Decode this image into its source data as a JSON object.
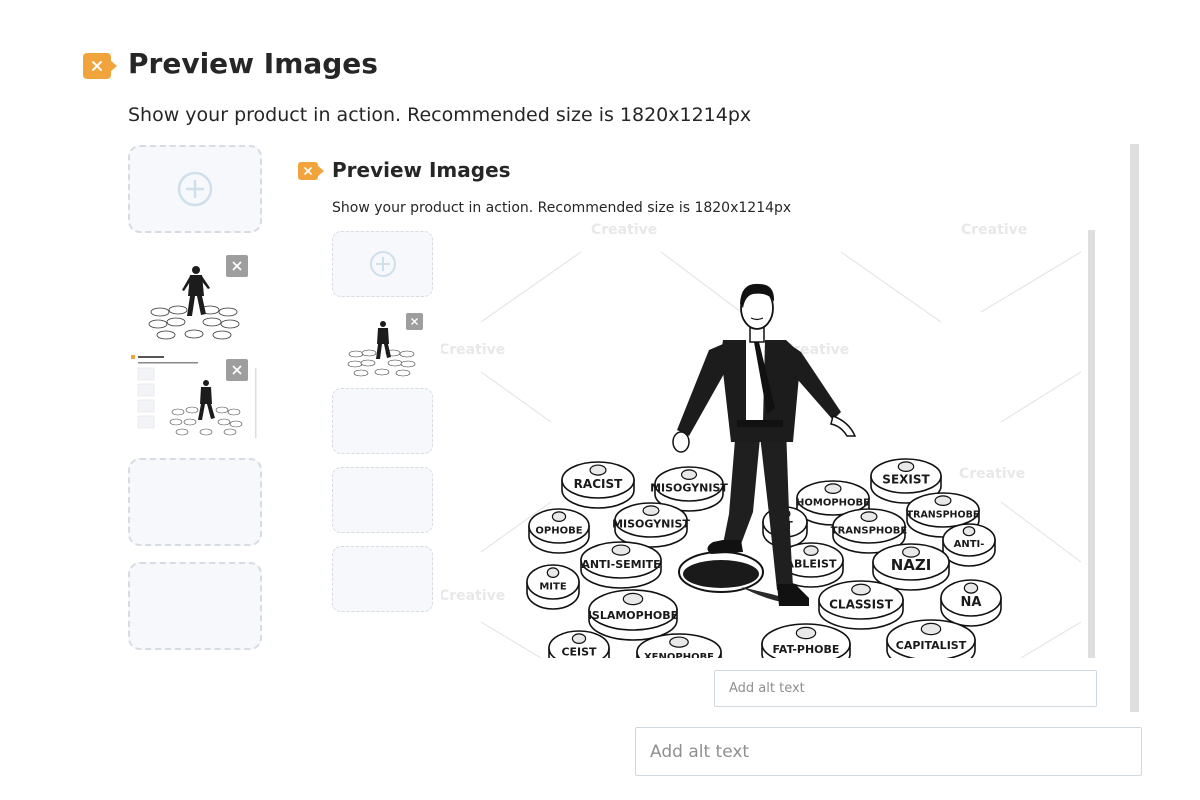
{
  "outer": {
    "title": "Preview Images",
    "subtitle": "Show your product in action. Recommended size is 1820x1214px",
    "alt_placeholder": "Add alt text"
  },
  "inner": {
    "title": "Preview Images",
    "subtitle": "Show your product in action. Recommended size is 1820x1214px",
    "alt_placeholder": "Add alt text"
  },
  "icons": {
    "badge": "close-x-badge-icon",
    "add": "plus-circle-icon",
    "remove": "close-icon"
  },
  "colors": {
    "accent": "#f2a43c",
    "slot_border": "#d7dbe3",
    "slot_bg": "#f7f8fb",
    "delete_bg": "#9e9e9e"
  },
  "illustration": {
    "mine_labels": [
      "RACIST",
      "MISOGYNIST",
      "SEXIST",
      "HOMOPHOBE",
      "TRANSPHOBE",
      "OPHOBE",
      "MISOGYNIST",
      "ST",
      "TRANSPHOBE",
      "ANTI-",
      "ANTI-SEMITE",
      "ABLEIST",
      "NAZI",
      "MITE",
      "CLASSIST",
      "NA",
      "ISLAMOPHOBE",
      "FAT-PHOBE",
      "CAPITALIST",
      "CEIST",
      "XENOPHOBE"
    ]
  }
}
